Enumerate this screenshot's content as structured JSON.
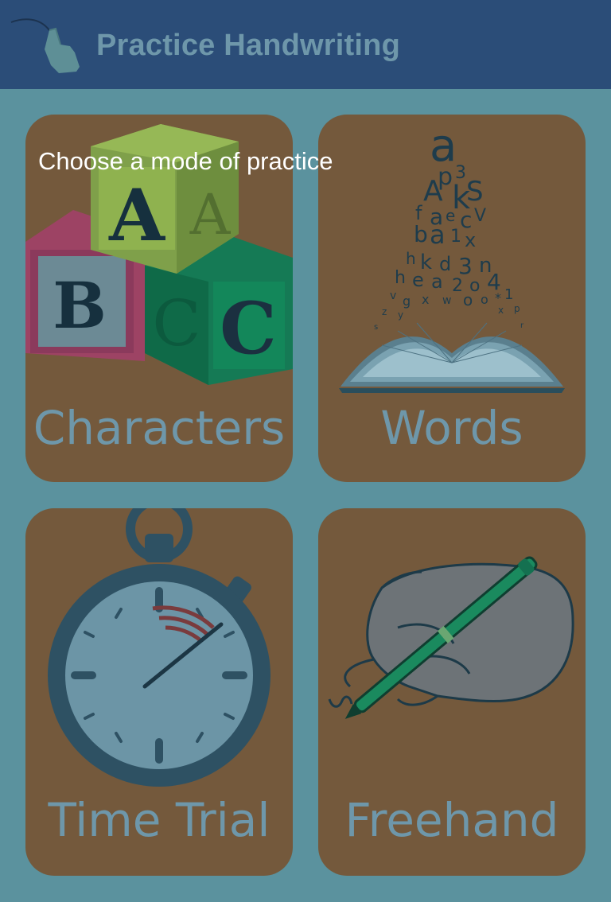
{
  "app": {
    "title": "Practice Handwriting",
    "logo_icon": "pointing-hand-icon"
  },
  "prompt": "Choose a mode of practice",
  "modes": [
    {
      "label": "Characters",
      "icon": "abc-blocks-icon"
    },
    {
      "label": "Words",
      "icon": "open-book-letters-icon"
    },
    {
      "label": "Time Trial",
      "icon": "stopwatch-icon"
    },
    {
      "label": "Freehand",
      "icon": "hand-writing-pen-icon"
    }
  ],
  "colors": {
    "appbar": "#2b4d78",
    "background": "#5b929e",
    "tile": "#74593c",
    "label_text": "#6e97aa",
    "prompt_text": "#ffffff"
  }
}
